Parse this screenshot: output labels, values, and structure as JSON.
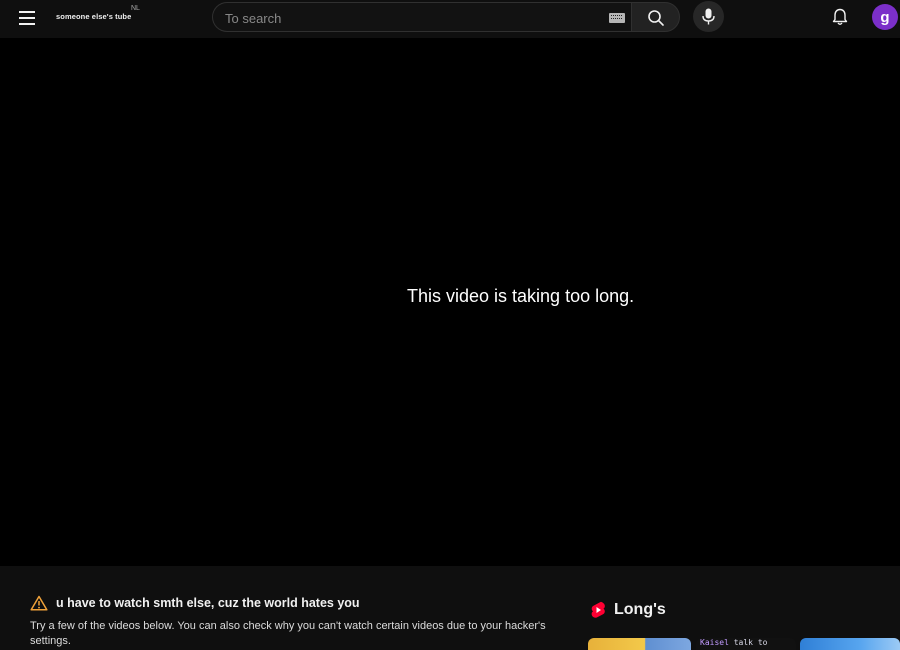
{
  "header": {
    "logo_text": "someone else's tube",
    "logo_superscript": "NL",
    "search_placeholder": "To search",
    "avatar_letter": "g"
  },
  "icons": {
    "menu": "hamburger-menu-icon",
    "keyboard": "keyboard-icon",
    "search": "search-icon",
    "mic": "microphone-icon",
    "notifications": "bell-icon",
    "warning": "warning-triangle-icon",
    "longs": "longs-play-icon"
  },
  "player": {
    "message": "This video is taking too long."
  },
  "notice": {
    "title": "u have to watch smth else, cuz the world hates you",
    "description": "Try a few of the videos below. You can also check why you can't watch certain videos due to your hacker's settings."
  },
  "longs": {
    "title": "Long's",
    "thumb_2_text_a": "Kaisel",
    "thumb_2_text_b": "talk to"
  },
  "colors": {
    "background": "#0f0f0f",
    "player": "#000000",
    "avatar": "#7b2fc9",
    "warning": "#f0a23a",
    "longs_brand": "#ff0033"
  }
}
